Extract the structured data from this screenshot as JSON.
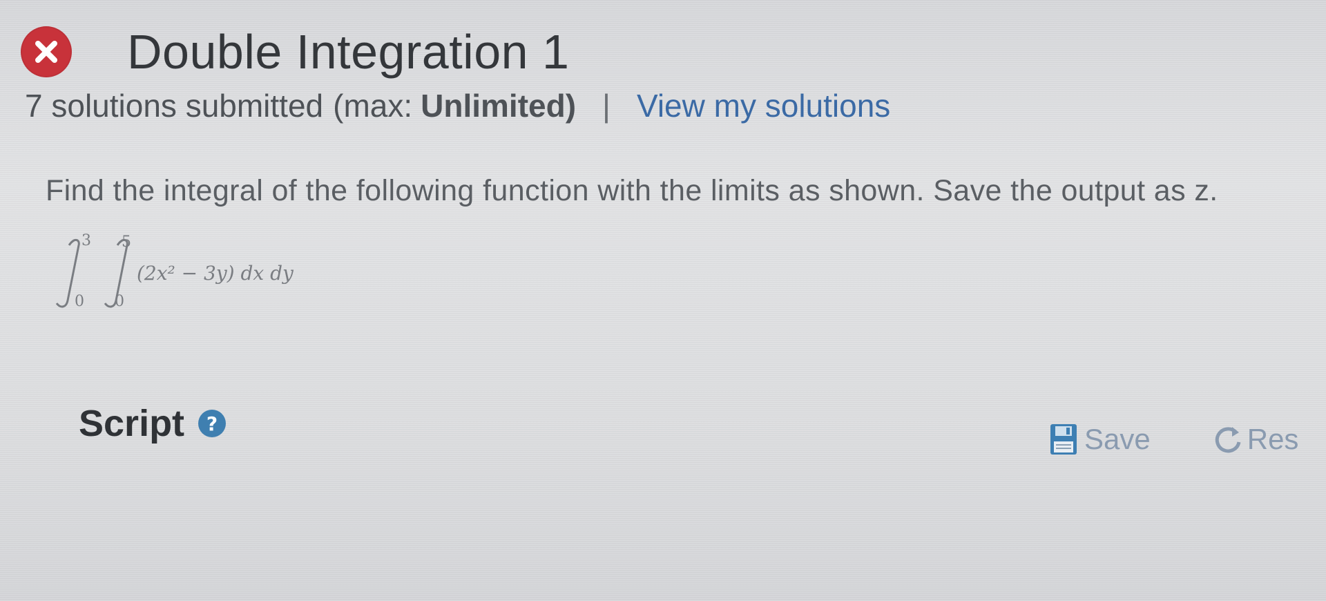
{
  "problem": {
    "title": "Double Integration 1",
    "status_icon": "close-icon",
    "submissions": {
      "count_text": "7 solutions submitted",
      "max_label": "(max:",
      "max_value": "Unlimited)",
      "separator": "|",
      "view_link": "View my solutions"
    },
    "instructions": "Find the integral of the following function with the limits as shown. Save the output as z.",
    "formula": {
      "outer_upper": "3",
      "outer_lower": "0",
      "inner_upper": "5",
      "inner_lower": "0",
      "integrand": "(2x² − 3y) dx dy"
    }
  },
  "script_section": {
    "label": "Script",
    "help_icon": "question-icon",
    "save_label": "Save",
    "save_icon": "floppy-disk-icon",
    "reset_label": "Res",
    "reset_icon": "reset-icon"
  },
  "colors": {
    "status_error": "#c8323a",
    "link": "#3b6aa5",
    "help_icon": "#3f7fb0",
    "toolbar_text": "#8a9bb0"
  }
}
